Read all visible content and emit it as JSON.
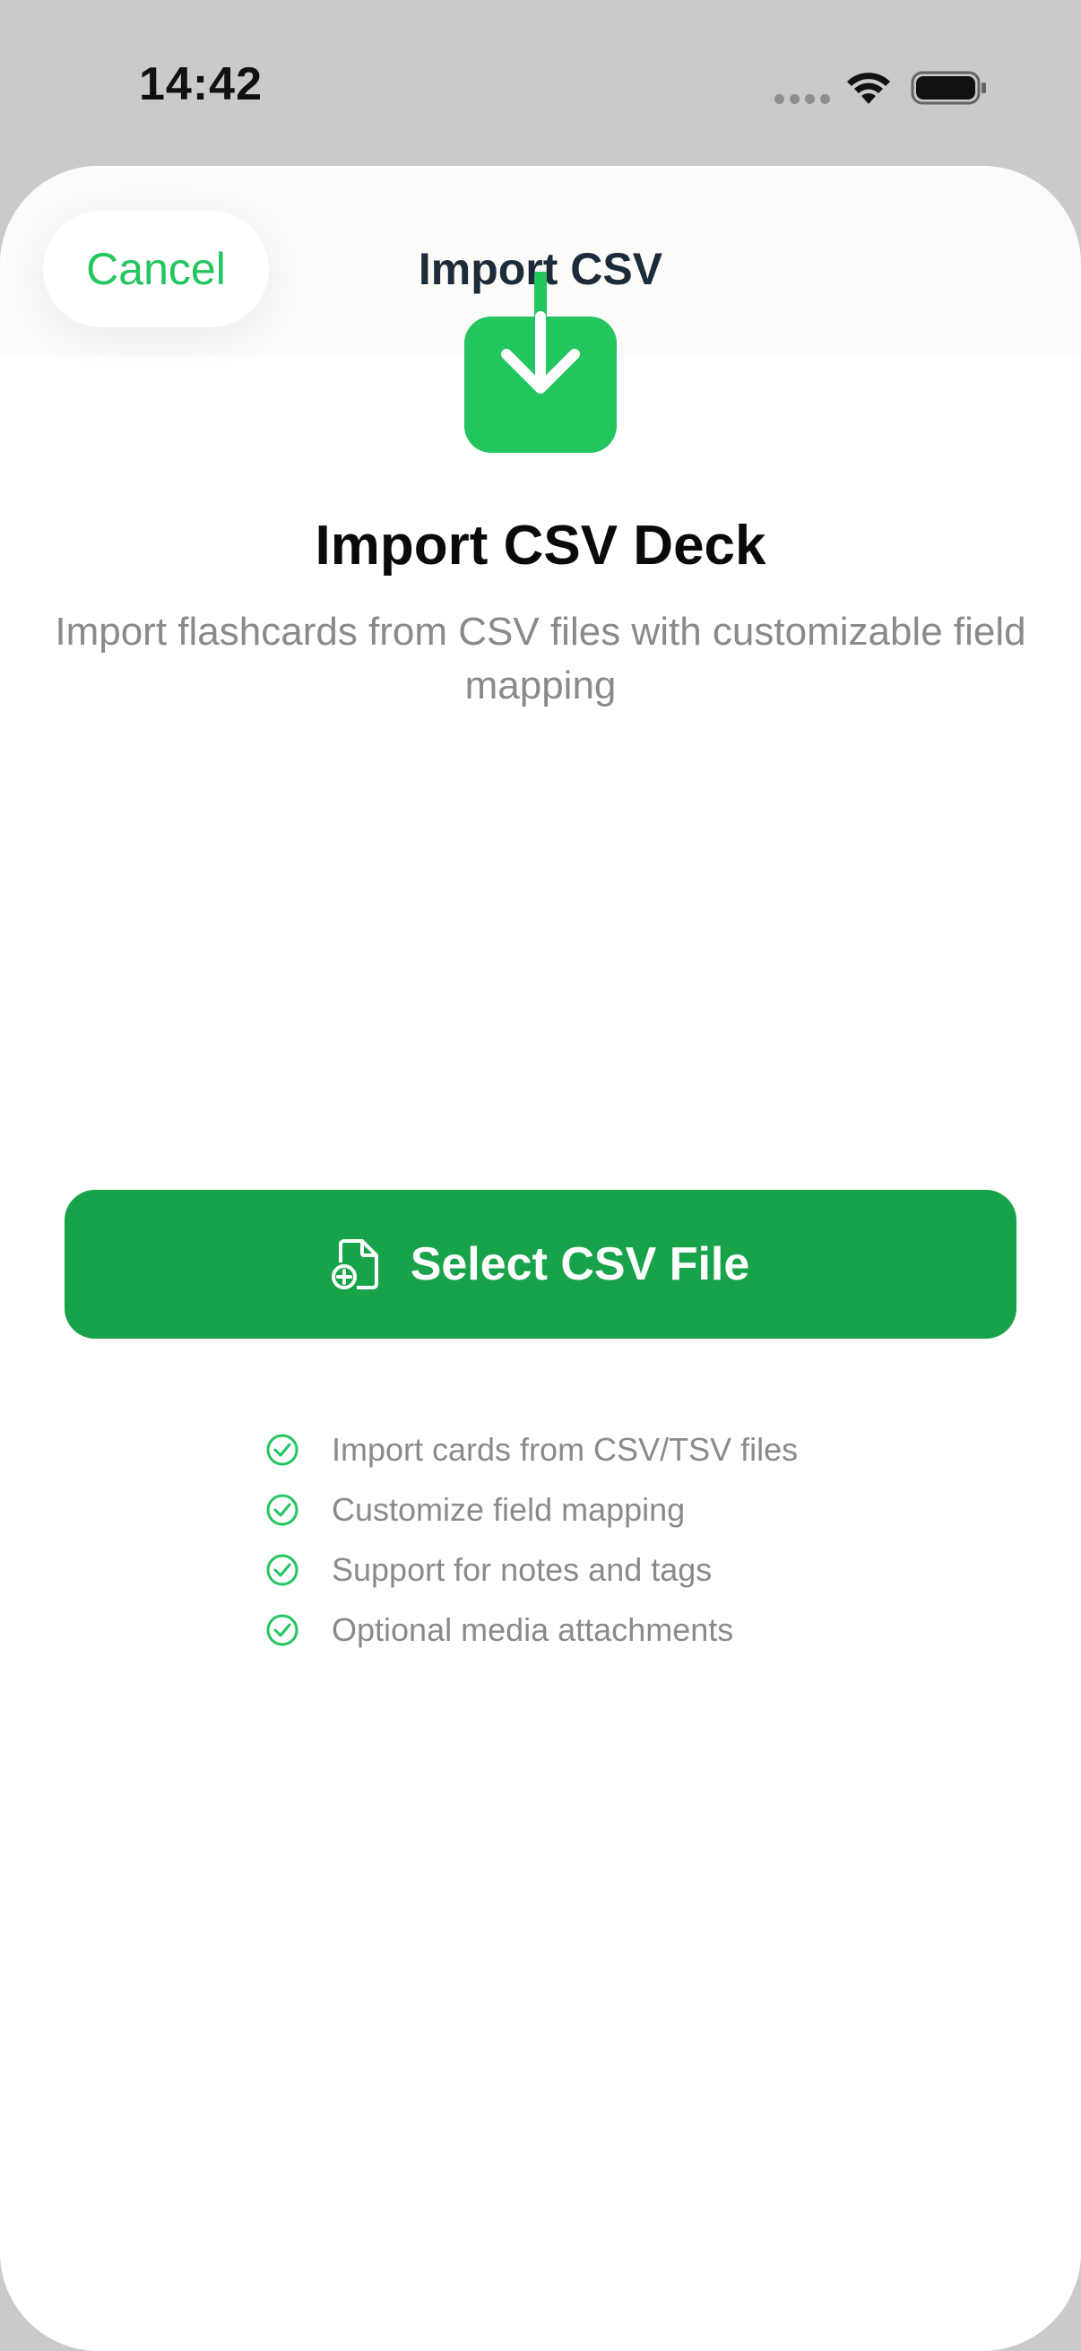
{
  "status_bar": {
    "time": "14:42"
  },
  "nav": {
    "cancel_label": "Cancel",
    "title": "Import CSV"
  },
  "hero": {
    "icon": "download-tray-icon",
    "title": "Import CSV Deck",
    "subtitle": "Import flashcards from CSV files with customizable field mapping"
  },
  "primary_button": {
    "icon": "document-add-icon",
    "label": "Select CSV File"
  },
  "features": [
    {
      "icon": "checkmark-circle-icon",
      "text": "Import cards from CSV/TSV files"
    },
    {
      "icon": "checkmark-circle-icon",
      "text": "Customize field mapping"
    },
    {
      "icon": "checkmark-circle-icon",
      "text": "Support for notes and tags"
    },
    {
      "icon": "checkmark-circle-icon",
      "text": "Optional media attachments"
    }
  ],
  "colors": {
    "accent": "#22c55e",
    "button": "#18a34a",
    "backdrop": "#cacaca",
    "muted_text": "#8a8a8a"
  }
}
